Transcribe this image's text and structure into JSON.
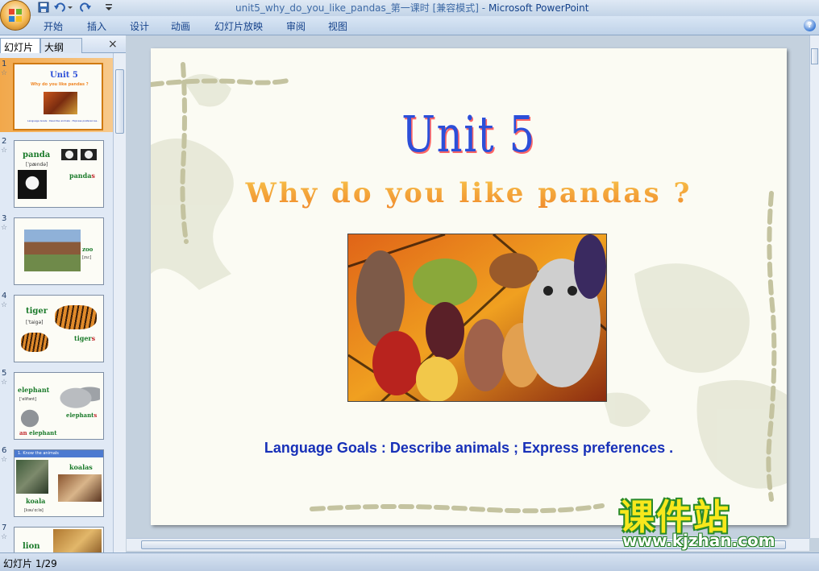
{
  "window": {
    "title_doc": "unit5_why_do_you_like_pandas_第一课时 [兼容模式] - ",
    "title_app": "Microsoft PowerPoint"
  },
  "ribbon": {
    "tabs": [
      "开始",
      "插入",
      "设计",
      "动画",
      "幻灯片放映",
      "审阅",
      "视图"
    ],
    "help": "?"
  },
  "left_pane": {
    "tabs": [
      "幻灯片",
      "大纲"
    ],
    "close": "×",
    "thumbnails": [
      {
        "num": "1",
        "title": "Unit 5",
        "subtitle": "Why do you like pandas ?",
        "caption": "Language Goals : Describe animals ; Express preferences ."
      },
      {
        "num": "2",
        "word": "panda",
        "phonetic": "[ˈpændə]",
        "plural_stem": "panda",
        "plural_suffix": "s"
      },
      {
        "num": "3",
        "word": "zoo",
        "phonetic": "[zuː]"
      },
      {
        "num": "4",
        "word": "tiger",
        "phonetic": "[ˈtaigə]",
        "plural_stem": "tiger",
        "plural_suffix": "s"
      },
      {
        "num": "5",
        "word": "elephant",
        "phonetic": "[ˈelifənt]",
        "plural_stem": "elephant",
        "plural_suffix": "s",
        "article": "an",
        "article_word": "elephant"
      },
      {
        "num": "6",
        "header": "1. Know the animals",
        "word": "koala",
        "phonetic": "[kəuˈɑːlə]",
        "plural": "koalas"
      },
      {
        "num": "7",
        "word": "lion"
      }
    ]
  },
  "slide": {
    "title": "Unit 5",
    "subtitle": "Why do you like pandas ?",
    "goals": "Language Goals : Describe animals ; Express preferences ."
  },
  "watermark": {
    "cn": "课件站",
    "url": "www.kjzhan.com"
  },
  "status": {
    "slide_counter": "幻灯片 1/29"
  },
  "colors": {
    "accent_title": "#2c4fd8",
    "goal_text": "#1730b8",
    "thumb_selected": "#f2a84b"
  }
}
